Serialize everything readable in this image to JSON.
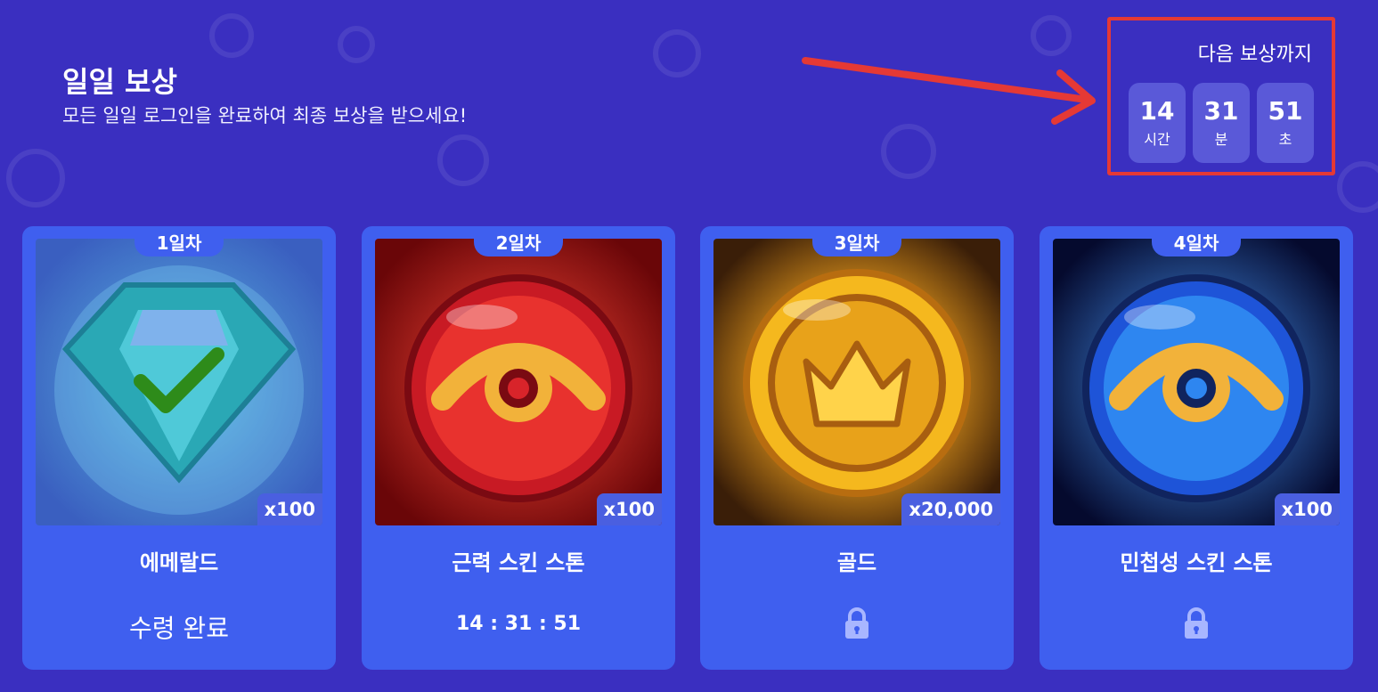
{
  "header": {
    "title": "일일 보상",
    "subtitle": "모든 일일 로그인을 완료하여 최종 보상을 받으세요!"
  },
  "timer": {
    "label": "다음 보상까지",
    "units": [
      {
        "value": "14",
        "label": "시간"
      },
      {
        "value": "31",
        "label": "분"
      },
      {
        "value": "51",
        "label": "초"
      }
    ]
  },
  "colors": {
    "background": "#3a2fc0",
    "card": "#3f5fef",
    "highlight": "#e53935",
    "check": "#2e8b1a"
  },
  "cards": [
    {
      "day": "1일차",
      "quantity": "x100",
      "name": "에메랄드",
      "status": "수령 완료",
      "icon": "emerald-icon",
      "state": "claimed"
    },
    {
      "day": "2일차",
      "quantity": "x100",
      "name": "근력 스킨 스톤",
      "status": "14 : 31 : 51",
      "icon": "strength-stone-icon",
      "state": "countdown"
    },
    {
      "day": "3일차",
      "quantity": "x20,000",
      "name": "골드",
      "icon": "gold-coin-icon",
      "state": "locked"
    },
    {
      "day": "4일차",
      "quantity": "x100",
      "name": "민첩성 스킨 스톤",
      "icon": "agility-stone-icon",
      "state": "locked"
    }
  ]
}
